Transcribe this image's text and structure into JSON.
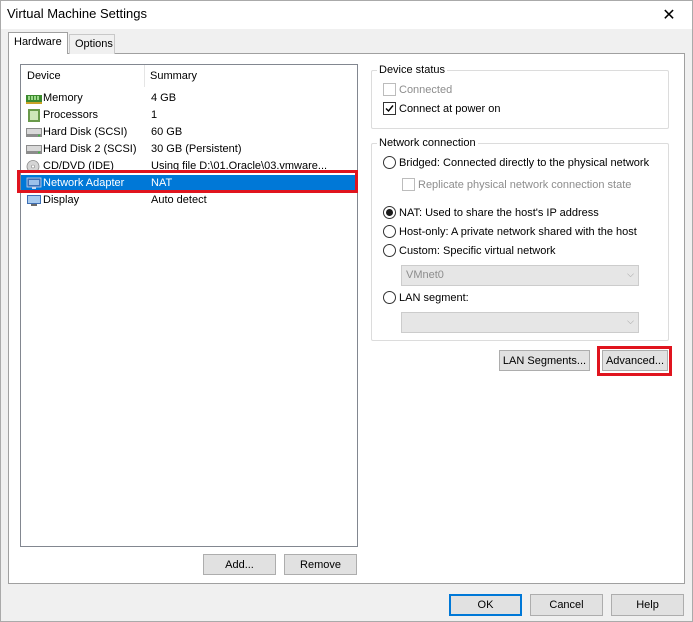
{
  "window": {
    "title": "Virtual Machine Settings"
  },
  "tabs": [
    {
      "label": "Hardware"
    },
    {
      "label": "Options"
    }
  ],
  "device_list": {
    "headers": {
      "device": "Device",
      "summary": "Summary"
    },
    "rows": [
      {
        "name": "Memory",
        "summary": "4 GB",
        "icon": "memory-icon"
      },
      {
        "name": "Processors",
        "summary": "1",
        "icon": "processor-icon"
      },
      {
        "name": "Hard Disk (SCSI)",
        "summary": "60 GB",
        "icon": "hard-disk-icon"
      },
      {
        "name": "Hard Disk 2 (SCSI)",
        "summary": "30 GB (Persistent)",
        "icon": "hard-disk-icon"
      },
      {
        "name": "CD/DVD (IDE)",
        "summary": "Using file D:\\01.Oracle\\03.vmware...",
        "icon": "cd-dvd-icon"
      },
      {
        "name": "Network Adapter",
        "summary": "NAT",
        "icon": "network-adapter-icon"
      },
      {
        "name": "Display",
        "summary": "Auto detect",
        "icon": "display-icon"
      }
    ],
    "selected_index": 5
  },
  "device_buttons": {
    "add": "Add...",
    "remove": "Remove"
  },
  "device_status": {
    "title": "Device status",
    "connected": {
      "label": "Connected",
      "checked": false,
      "enabled": false
    },
    "connect_at_power_on": {
      "label": "Connect at power on",
      "checked": true,
      "enabled": true
    }
  },
  "network_connection": {
    "title": "Network connection",
    "bridged": {
      "label": "Bridged: Connected directly to the physical network",
      "selected": false
    },
    "replicate": {
      "label": "Replicate physical network connection state",
      "checked": false,
      "enabled": false
    },
    "nat": {
      "label": "NAT: Used to share the host's IP address",
      "selected": true
    },
    "host_only": {
      "label": "Host-only: A private network shared with the host",
      "selected": false
    },
    "custom": {
      "label": "Custom: Specific virtual network",
      "selected": false
    },
    "custom_select": {
      "value": "VMnet0"
    },
    "lan_segment": {
      "label": "LAN segment:",
      "selected": false
    },
    "lan_select": {
      "value": ""
    }
  },
  "network_buttons": {
    "lan_segments": "LAN Segments...",
    "advanced": "Advanced..."
  },
  "footer": {
    "ok": "OK",
    "cancel": "Cancel",
    "help": "Help"
  },
  "colors": {
    "selection": "#0078d7",
    "highlight_box": "#e0141e",
    "default_button_border": "#0078d7"
  }
}
